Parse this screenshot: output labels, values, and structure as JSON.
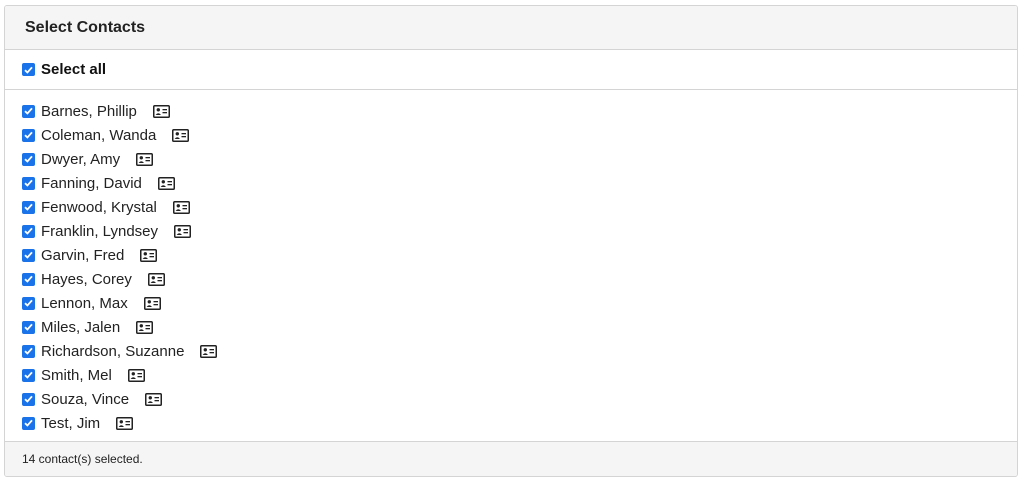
{
  "header": {
    "title": "Select Contacts"
  },
  "select_all": {
    "label": "Select all",
    "checked": true
  },
  "contacts": [
    {
      "name": "Barnes, Phillip",
      "checked": true,
      "icon": "contact-card-icon"
    },
    {
      "name": "Coleman, Wanda",
      "checked": true,
      "icon": "contact-card-icon"
    },
    {
      "name": "Dwyer, Amy",
      "checked": true,
      "icon": "contact-card-icon"
    },
    {
      "name": "Fanning, David",
      "checked": true,
      "icon": "contact-card-icon"
    },
    {
      "name": "Fenwood, Krystal",
      "checked": true,
      "icon": "contact-card-icon"
    },
    {
      "name": "Franklin, Lyndsey",
      "checked": true,
      "icon": "contact-card-icon"
    },
    {
      "name": "Garvin, Fred",
      "checked": true,
      "icon": "contact-card-icon"
    },
    {
      "name": "Hayes, Corey",
      "checked": true,
      "icon": "contact-card-icon"
    },
    {
      "name": "Lennon, Max",
      "checked": true,
      "icon": "contact-card-icon"
    },
    {
      "name": "Miles, Jalen",
      "checked": true,
      "icon": "contact-card-icon"
    },
    {
      "name": "Richardson, Suzanne",
      "checked": true,
      "icon": "contact-card-icon"
    },
    {
      "name": "Smith, Mel",
      "checked": true,
      "icon": "contact-card-icon"
    },
    {
      "name": "Souza, Vince",
      "checked": true,
      "icon": "contact-card-icon"
    },
    {
      "name": "Test, Jim",
      "checked": true,
      "icon": "contact-card-icon"
    }
  ],
  "footer": {
    "status": "14 contact(s) selected."
  },
  "colors": {
    "checkbox": "#1a73e8",
    "header_bg": "#f5f5f5",
    "border": "#d4d4d4"
  }
}
